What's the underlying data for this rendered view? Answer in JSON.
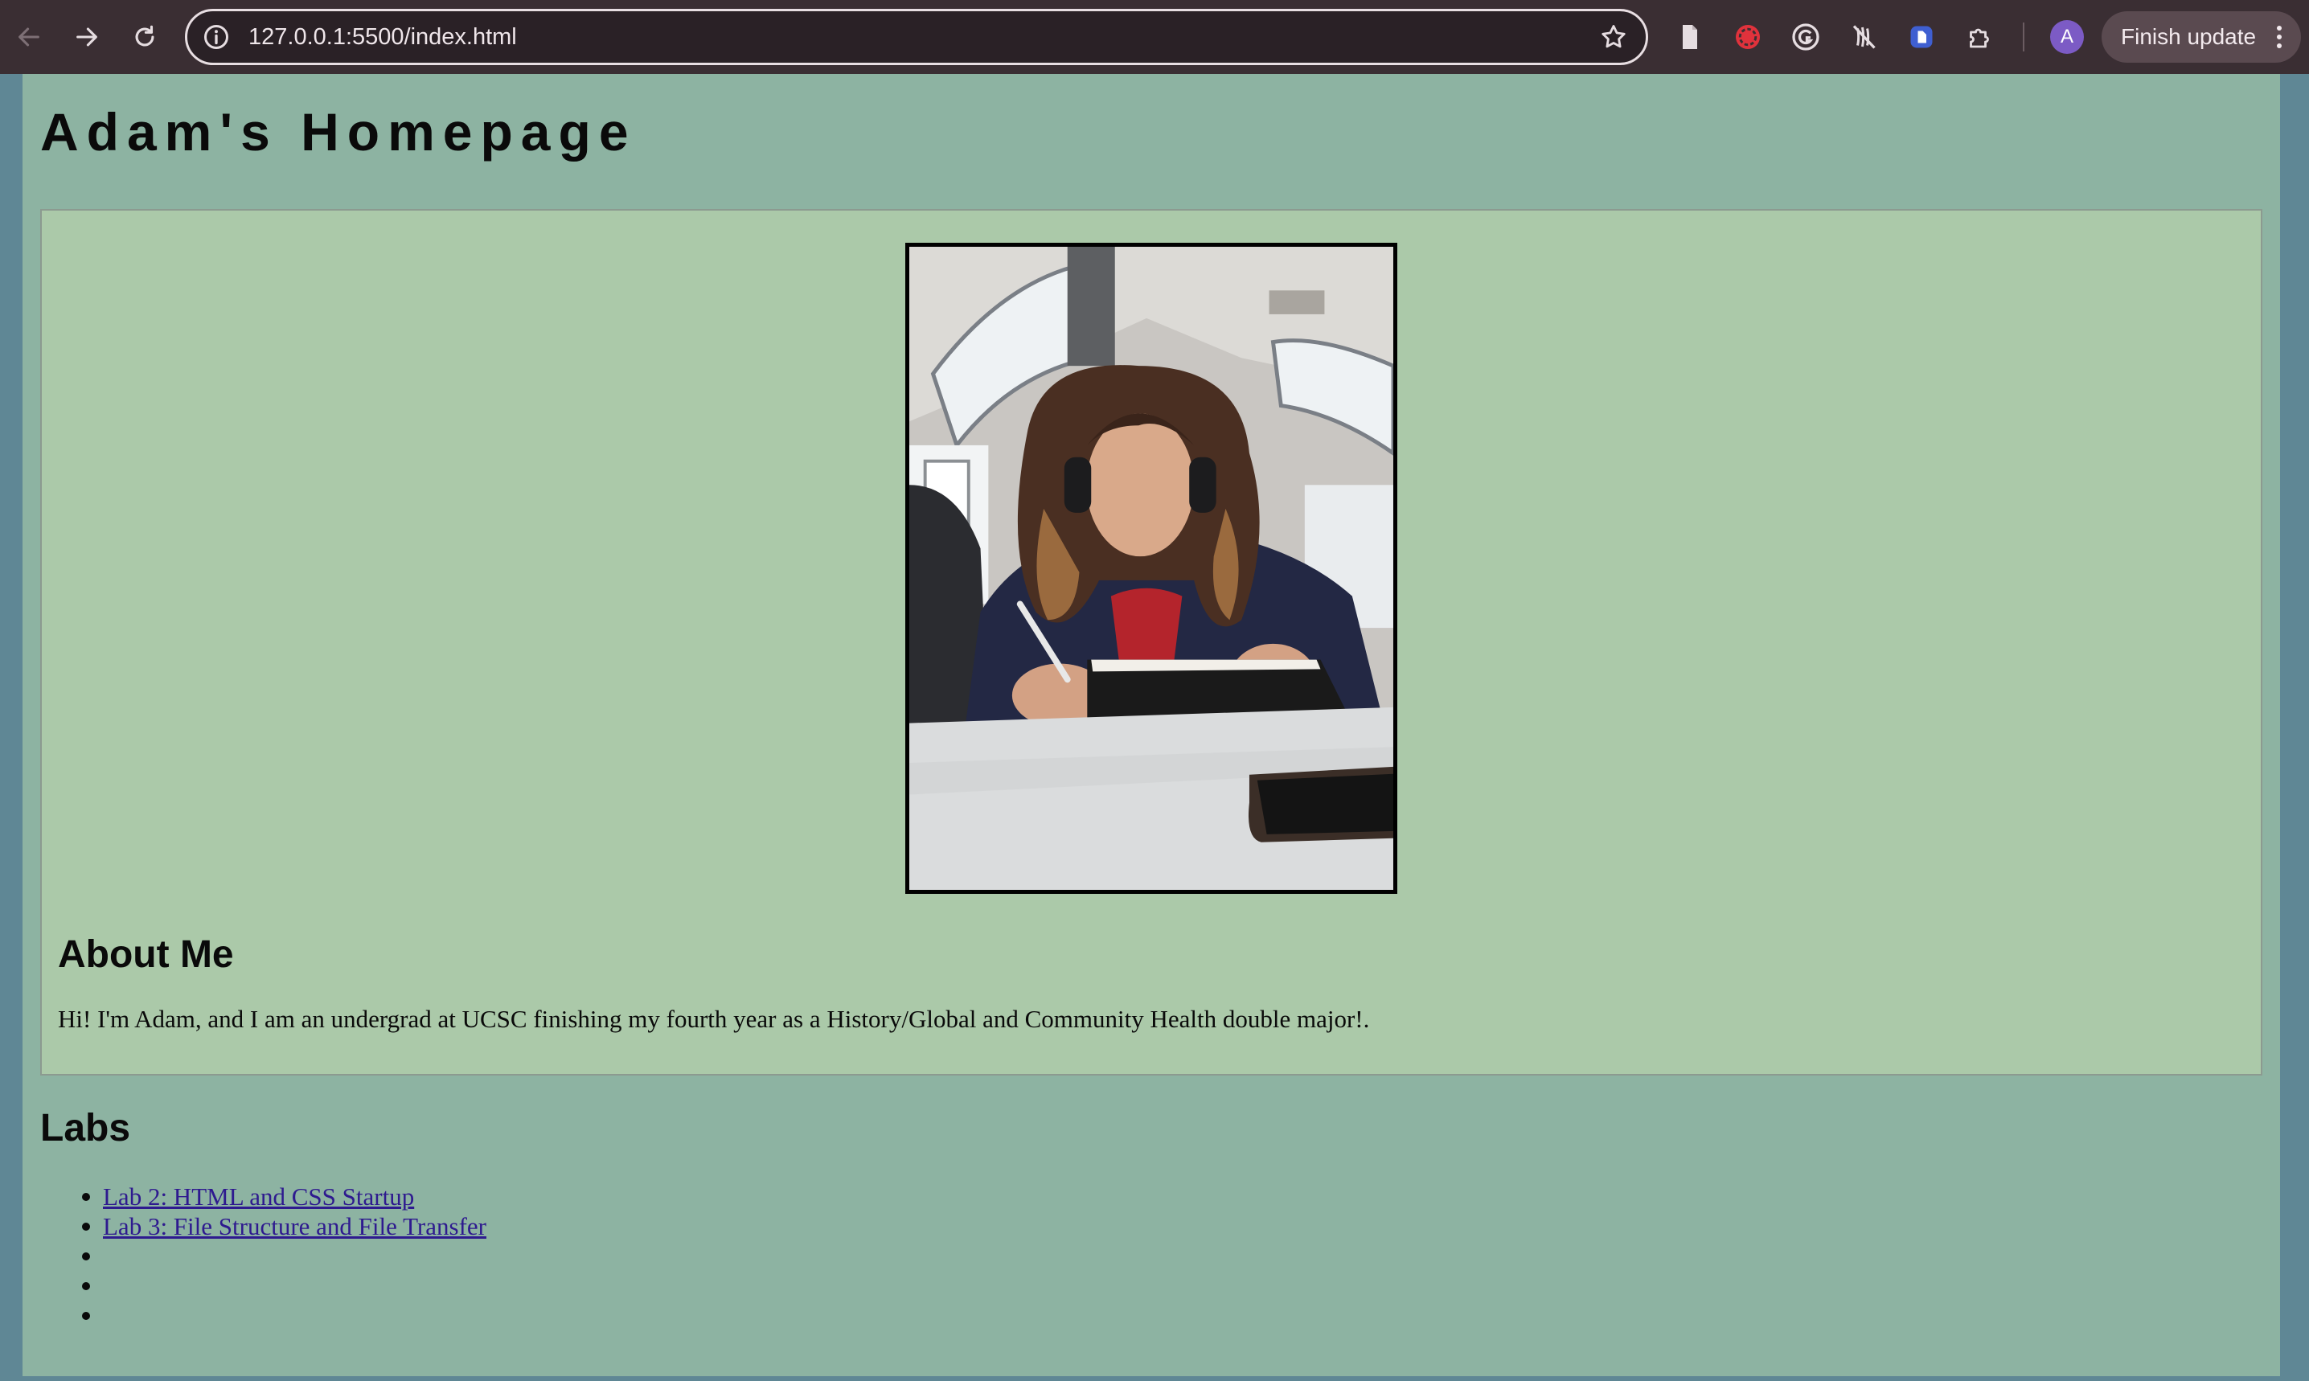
{
  "browser": {
    "url": "127.0.0.1:5500/index.html",
    "profile_initial": "A",
    "finish_update_label": "Finish update",
    "icons": {
      "back": "arrow-left-icon",
      "forward": "arrow-right-icon",
      "reload": "reload-icon",
      "site_info": "info-icon",
      "bookmark": "star-icon",
      "extensions": [
        "document-icon",
        "red-extension-icon",
        "grammarly-icon",
        "no-tracking-icon",
        "blue-document-icon",
        "puzzle-icon"
      ],
      "menu": "kebab-menu-icon"
    }
  },
  "page": {
    "title": "Adam's Homepage",
    "about": {
      "heading": "About Me",
      "text": "Hi! I'm Adam, and I am an undergrad at UCSC finishing my fourth year as a History/Global and Community Health double major!."
    },
    "labs": {
      "heading": "Labs",
      "items": [
        {
          "label": "Lab 2: HTML and CSS Startup"
        },
        {
          "label": "Lab 3: File Structure and File Transfer"
        },
        {
          "label": ""
        },
        {
          "label": ""
        },
        {
          "label": ""
        }
      ]
    },
    "colors": {
      "page_background": "#8db3a2",
      "about_box_background": "#abc9a9",
      "link": "#2e1a8f"
    }
  }
}
